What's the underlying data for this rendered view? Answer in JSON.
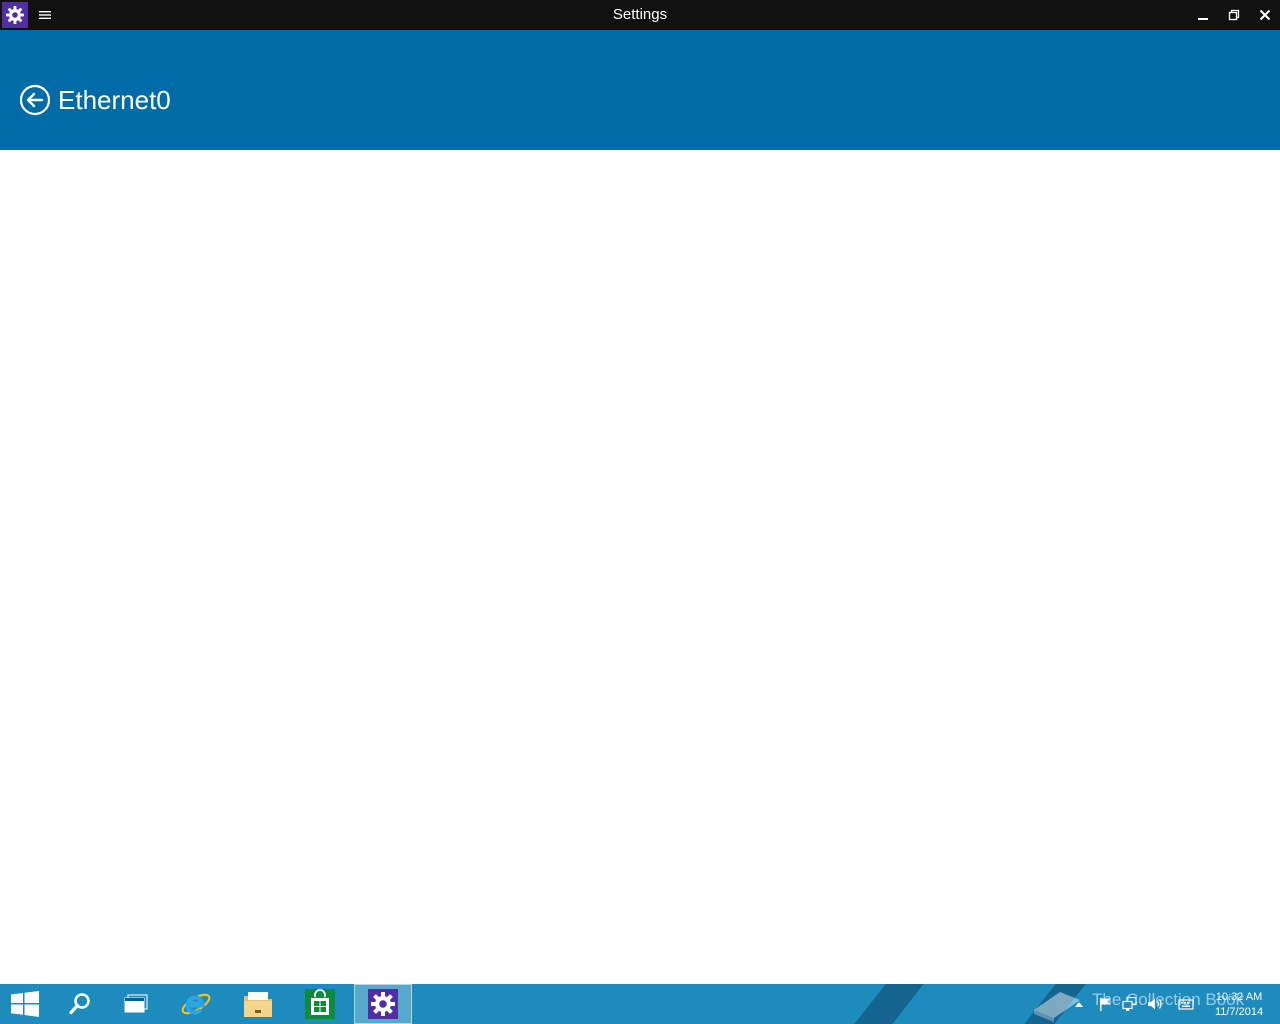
{
  "titlebar": {
    "title": "Settings",
    "app_icon": "gear-icon",
    "menu_icon": "hamburger-icon",
    "minimize_icon": "minimize-icon",
    "restore_icon": "restore-icon",
    "close_icon": "close-icon"
  },
  "header": {
    "back_icon": "back-arrow-icon",
    "title": "Ethernet0",
    "background": "#006ba6"
  },
  "taskbar": {
    "background": "#1e8bbd",
    "buttons": [
      {
        "name": "start",
        "icon": "windows-logo-icon"
      },
      {
        "name": "search",
        "icon": "search-icon"
      },
      {
        "name": "task-view",
        "icon": "task-view-icon"
      },
      {
        "name": "internet-explorer",
        "icon": "ie-icon"
      },
      {
        "name": "file-explorer",
        "icon": "folder-icon"
      },
      {
        "name": "store",
        "icon": "store-icon"
      },
      {
        "name": "settings",
        "icon": "gear-icon",
        "active": true
      }
    ],
    "watermark": "The Collection Book",
    "tray_icons": [
      "chevron-up-icon",
      "flag-icon",
      "network-icon",
      "volume-icon",
      "keyboard-icon"
    ],
    "clock": {
      "time": "10:32 AM",
      "date": "11/7/2014"
    }
  }
}
